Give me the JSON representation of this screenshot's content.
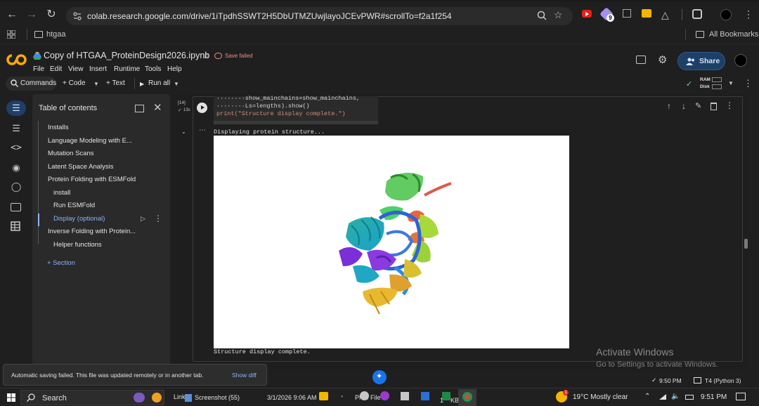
{
  "browser": {
    "url": "colab.research.google.com/drive/1iTpdhSSWT2H5DbUTMZUwjlayoJCEvPWR#scrollTo=f2a1f254",
    "bookmark_folder": "htgaa",
    "all_bookmarks": "All Bookmarks",
    "extension_badge": "9"
  },
  "colab": {
    "notebook_title": "Copy of HTGAA_ProteinDesign2026.ipynb",
    "save_status": "Save failed",
    "menu": [
      "File",
      "Edit",
      "View",
      "Insert",
      "Runtime",
      "Tools",
      "Help"
    ],
    "share_label": "Share",
    "ram_label": "RAM",
    "disk_label": "Disk"
  },
  "toolbar": {
    "commands": "Commands",
    "code": "+ Code",
    "text": "+ Text",
    "run_all": "Run all"
  },
  "toc": {
    "title": "Table of contents",
    "items": [
      {
        "label": "Installs",
        "indent": 0,
        "active": false
      },
      {
        "label": "Language Modeling with E...",
        "indent": 0,
        "active": false
      },
      {
        "label": "Mutation Scans",
        "indent": 0,
        "active": false
      },
      {
        "label": "Latent Space Analysis",
        "indent": 0,
        "active": false
      },
      {
        "label": "Protein Folding with ESMFold",
        "indent": 0,
        "active": false
      },
      {
        "label": "install",
        "indent": 1,
        "active": false
      },
      {
        "label": "Run ESMFold",
        "indent": 1,
        "active": false
      },
      {
        "label": "Display (optional)",
        "indent": 1,
        "active": true
      },
      {
        "label": "Inverse Folding with Protein...",
        "indent": 0,
        "active": false
      },
      {
        "label": "Helper functions",
        "indent": 1,
        "active": false
      }
    ],
    "add_section": "+ Section"
  },
  "cell": {
    "exec_count": "[14]",
    "exec_time": "13s",
    "code_lines": [
      "········show_mainchains=show_mainchains,",
      "········Ls=lengths).show()",
      "print(\"Structure display complete.\")"
    ],
    "output_line1": "Displaying protein structure...",
    "output_line2": "Structure display complete."
  },
  "watermark": {
    "line1": "Activate Windows",
    "line2": "Go to Settings to activate Windows."
  },
  "toast": {
    "message": "Automatic saving failed. This file was updated remotely or in another tab.",
    "action": "Show diff"
  },
  "statusbar": {
    "time": "9:50 PM",
    "runtime": "T4 (Python 3)"
  },
  "taskbar": {
    "search": "Search",
    "links": "Link",
    "screenshot": "Screenshot (55)",
    "screenshot_date": "3/1/2026 9:06 AM",
    "png_file": "PNG File",
    "kb": "1",
    "kb_unit": "KB",
    "weather": "19°C  Mostly clear",
    "clock": "9:51 PM",
    "weather_badge": "1"
  }
}
